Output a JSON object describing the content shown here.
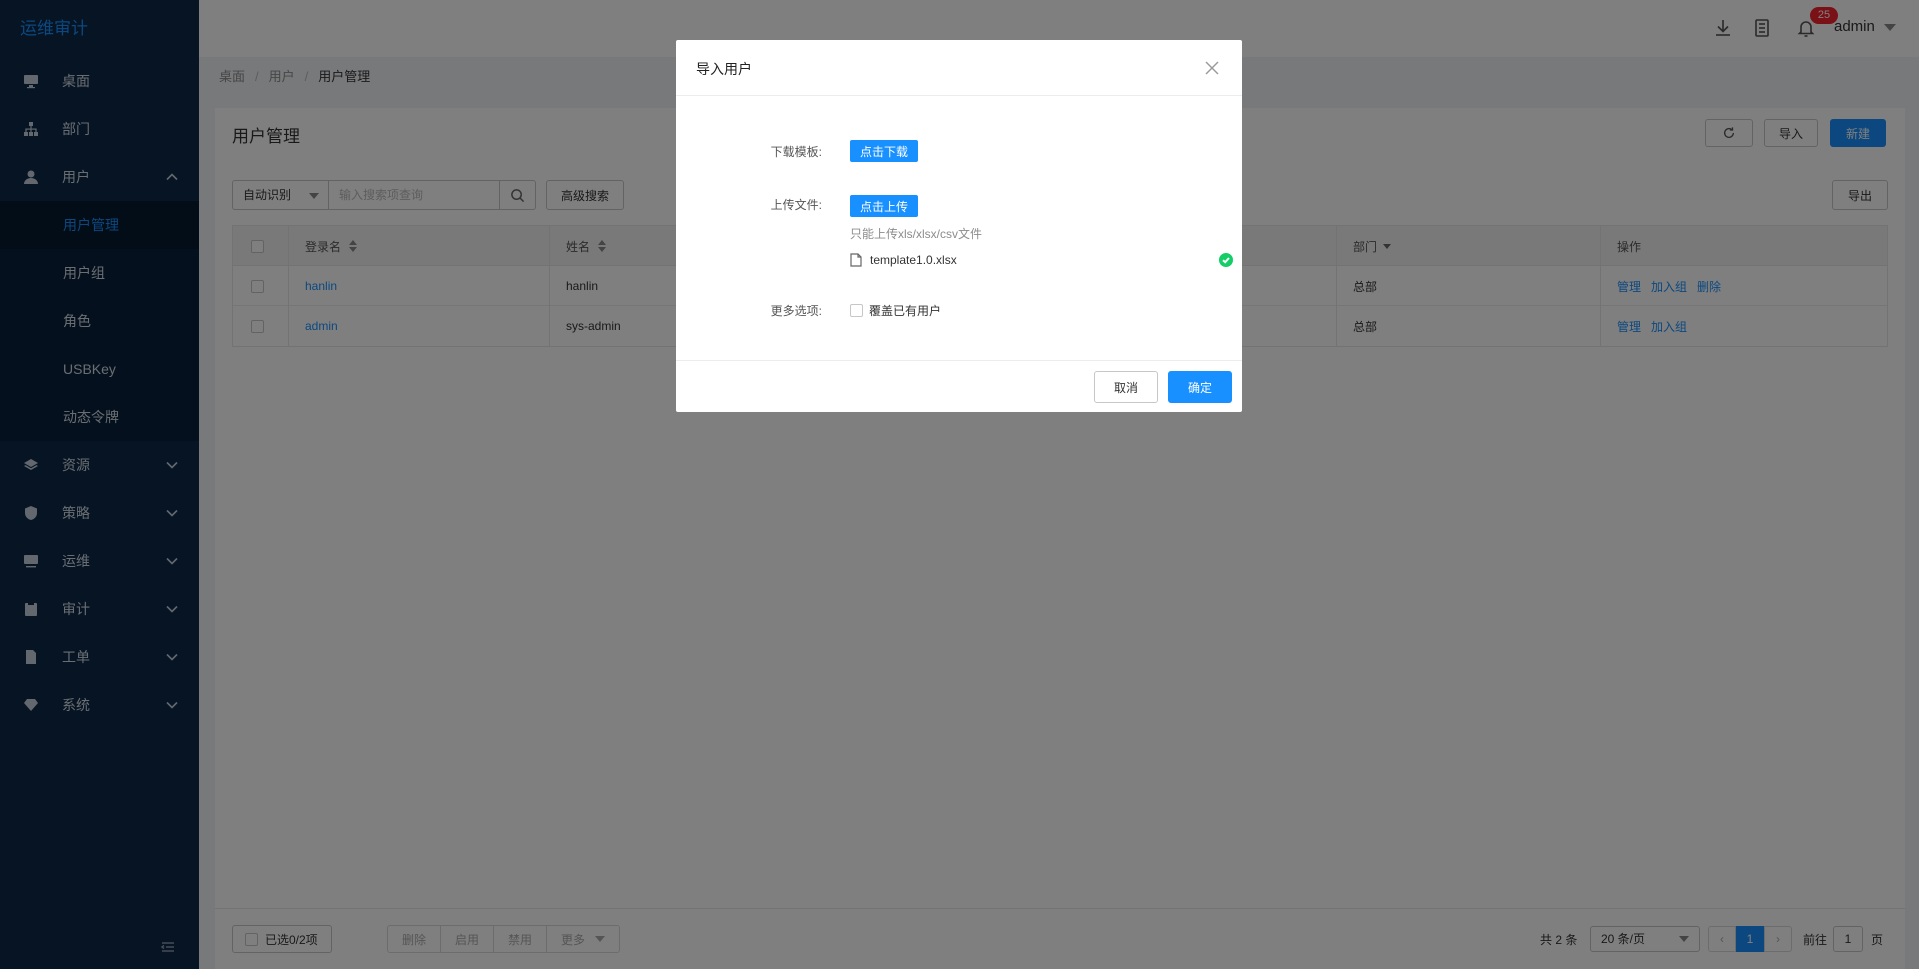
{
  "app": {
    "brand": "运维审计"
  },
  "sidebar": {
    "items": [
      {
        "label": "桌面",
        "icon": "desktop-icon"
      },
      {
        "label": "部门",
        "icon": "org-chart-icon"
      },
      {
        "label": "用户",
        "icon": "user-icon",
        "expanded": true
      },
      {
        "label": "资源",
        "icon": "layers-icon"
      },
      {
        "label": "策略",
        "icon": "shield-icon"
      },
      {
        "label": "运维",
        "icon": "monitor-icon"
      },
      {
        "label": "审计",
        "icon": "clipboard-icon"
      },
      {
        "label": "工单",
        "icon": "document-icon"
      },
      {
        "label": "系统",
        "icon": "diamond-icon"
      }
    ],
    "user_submenu": [
      "用户管理",
      "用户组",
      "角色",
      "USBKey",
      "动态令牌"
    ],
    "active_sub": "用户管理"
  },
  "header": {
    "notification_count": "25",
    "username": "admin"
  },
  "breadcrumb": [
    "桌面",
    "用户",
    "用户管理"
  ],
  "page": {
    "title": "用户管理",
    "buttons": {
      "import": "导入",
      "create": "新建",
      "export": "导出",
      "advanced_search": "高级搜索"
    },
    "search": {
      "mode": "自动识别",
      "placeholder": "输入搜索项查询"
    }
  },
  "table": {
    "headers": {
      "login": "登录名",
      "name": "姓名",
      "dept": "部门",
      "ops": "操作"
    },
    "rows": [
      {
        "login": "hanlin",
        "name": "hanlin",
        "dept": "总部",
        "ops": [
          "管理",
          "加入组",
          "删除"
        ]
      },
      {
        "login": "admin",
        "name": "sys-admin",
        "dept": "总部",
        "ops": [
          "管理",
          "加入组"
        ]
      }
    ]
  },
  "footer": {
    "selected": "已选0/2项",
    "bulk": [
      "删除",
      "启用",
      "禁用",
      "更多"
    ],
    "total": "共 2 条",
    "page_size": "20 条/页",
    "current_page": "1",
    "goto_label": "前往",
    "goto_value": "1",
    "goto_unit": "页"
  },
  "modal": {
    "title": "导入用户",
    "download_label": "下载模板:",
    "download_btn": "点击下载",
    "upload_label": "上传文件:",
    "upload_btn": "点击上传",
    "hint": "只能上传xls/xlsx/csv文件",
    "file_name": "template1.0.xlsx",
    "options_label": "更多选项:",
    "overwrite": "覆盖已有用户",
    "cancel": "取消",
    "ok": "确定"
  },
  "colors": {
    "primary": "#1890ff",
    "sidebar_bg": "#0d2947",
    "success": "#13ce66",
    "badge": "#f5222d"
  }
}
